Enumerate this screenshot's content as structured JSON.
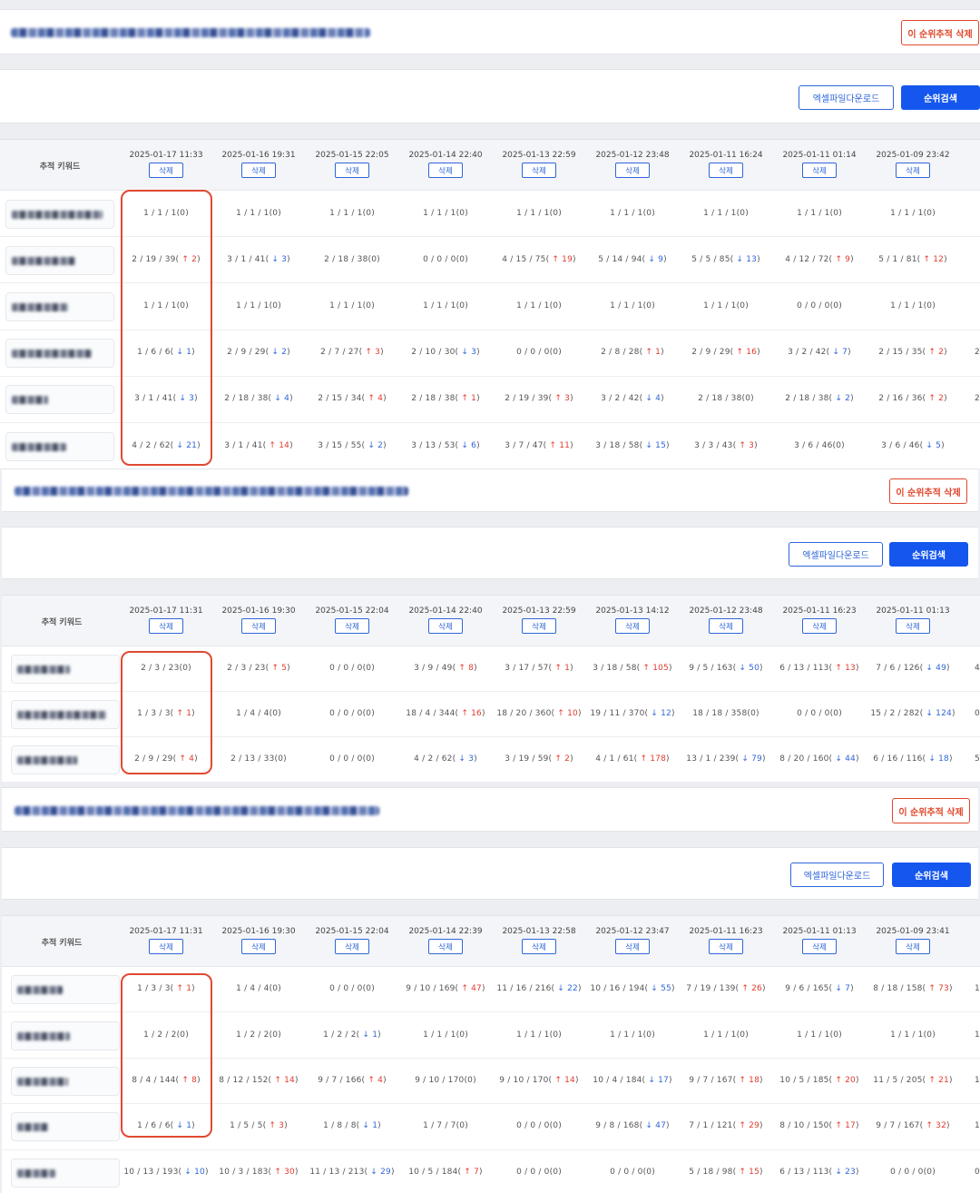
{
  "labels": {
    "delete_tracking": "이 순위추적 삭제",
    "excel_download": "엑셀파일다운로드",
    "rank_search": "순위검색",
    "tracking_keyword": "추적 키워드",
    "delete": "삭제"
  },
  "colors": {
    "accent": "#1557ee",
    "danger": "#e0472b",
    "up_arrow": "#e23a2a",
    "down_arrow": "#2f66d9"
  },
  "tables": [
    {
      "dates": [
        "2025-01-17 11:33",
        "2025-01-16 19:31",
        "2025-01-15 22:05",
        "2025-01-14 22:40",
        "2025-01-13 22:59",
        "2025-01-12 23:48",
        "2025-01-11 16:24",
        "2025-01-11 01:14",
        "2025-01-09 23:42",
        "20"
      ],
      "rows": [
        [
          "1 / 1 / 1(0)",
          "1 / 1 / 1(0)",
          "1 / 1 / 1(0)",
          "1 / 1 / 1(0)",
          "1 / 1 / 1(0)",
          "1 / 1 / 1(0)",
          "1 / 1 / 1(0)",
          "1 / 1 / 1(0)",
          "1 / 1 / 1(0)",
          ""
        ],
        [
          "2 / 19 / 39( ↑ 2)",
          "3 / 1 / 41( ↓ 3)",
          "2 / 18 / 38(0)",
          "0 / 0 / 0(0)",
          "4 / 15 / 75( ↑ 19)",
          "5 / 14 / 94( ↓ 9)",
          "5 / 5 / 85( ↓ 13)",
          "4 / 12 / 72( ↑ 9)",
          "5 / 1 / 81( ↑ 12)",
          ""
        ],
        [
          "1 / 1 / 1(0)",
          "1 / 1 / 1(0)",
          "1 / 1 / 1(0)",
          "1 / 1 / 1(0)",
          "1 / 1 / 1(0)",
          "1 / 1 / 1(0)",
          "1 / 1 / 1(0)",
          "0 / 0 / 0(0)",
          "1 / 1 / 1(0)",
          ""
        ],
        [
          "1 / 6 / 6( ↓ 1)",
          "2 / 9 / 29( ↓ 2)",
          "2 / 7 / 27( ↑ 3)",
          "2 / 10 / 30( ↓ 3)",
          "0 / 0 / 0(0)",
          "2 / 8 / 28( ↑ 1)",
          "2 / 9 / 29( ↑ 16)",
          "3 / 2 / 42( ↓ 7)",
          "2 / 15 / 35( ↑ 2)",
          "2"
        ],
        [
          "3 / 1 / 41( ↓ 3)",
          "2 / 18 / 38( ↓ 4)",
          "2 / 15 / 34( ↑ 4)",
          "2 / 18 / 38( ↑ 1)",
          "2 / 19 / 39( ↑ 3)",
          "3 / 2 / 42( ↓ 4)",
          "2 / 18 / 38(0)",
          "2 / 18 / 38( ↓ 2)",
          "2 / 16 / 36( ↑ 2)",
          "2"
        ],
        [
          "4 / 2 / 62( ↓ 21)",
          "3 / 1 / 41( ↑ 14)",
          "3 / 15 / 55( ↓ 2)",
          "3 / 13 / 53( ↓ 6)",
          "3 / 7 / 47( ↑ 11)",
          "3 / 18 / 58( ↓ 15)",
          "3 / 3 / 43( ↑ 3)",
          "3 / 6 / 46(0)",
          "3 / 6 / 46( ↓ 5)",
          ""
        ]
      ]
    },
    {
      "dates": [
        "2025-01-17 11:31",
        "2025-01-16 19:30",
        "2025-01-15 22:04",
        "2025-01-14 22:40",
        "2025-01-13 22:59",
        "2025-01-13 14:12",
        "2025-01-12 23:48",
        "2025-01-11 16:23",
        "2025-01-11 01:13",
        "2025"
      ],
      "rows": [
        [
          "2 / 3 / 23(0)",
          "2 / 3 / 23( ↑ 5)",
          "0 / 0 / 0(0)",
          "3 / 9 / 49( ↑ 8)",
          "3 / 17 / 57( ↑ 1)",
          "3 / 18 / 58( ↑ 105)",
          "9 / 5 / 163( ↓ 50)",
          "6 / 13 / 113( ↑ 13)",
          "7 / 6 / 126( ↓ 49)",
          "4 /"
        ],
        [
          "1 / 3 / 3( ↑ 1)",
          "1 / 4 / 4(0)",
          "0 / 0 / 0(0)",
          "18 / 4 / 344( ↑ 16)",
          "18 / 20 / 360( ↑ 10)",
          "19 / 11 / 370( ↓ 12)",
          "18 / 18 / 358(0)",
          "0 / 0 / 0(0)",
          "15 / 2 / 282( ↓ 124)",
          "0,"
        ],
        [
          "2 / 9 / 29( ↑ 4)",
          "2 / 13 / 33(0)",
          "0 / 0 / 0(0)",
          "4 / 2 / 62( ↓ 3)",
          "3 / 19 / 59( ↑ 2)",
          "4 / 1 / 61( ↑ 178)",
          "13 / 1 / 239( ↓ 79)",
          "8 / 20 / 160( ↓ 44)",
          "6 / 16 / 116( ↓ 18)",
          "5 / 18"
        ]
      ]
    },
    {
      "dates": [
        "2025-01-17 11:31",
        "2025-01-16 19:30",
        "2025-01-15 22:04",
        "2025-01-14 22:39",
        "2025-01-13 22:58",
        "2025-01-12 23:47",
        "2025-01-11 16:23",
        "2025-01-11 01:13",
        "2025-01-09 23:41",
        "2025"
      ],
      "rows": [
        [
          "1 / 3 / 3( ↑ 1)",
          "1 / 4 / 4(0)",
          "0 / 0 / 0(0)",
          "9 / 10 / 169( ↑ 47)",
          "11 / 16 / 216( ↓ 22)",
          "10 / 16 / 194( ↓ 55)",
          "7 / 19 / 139( ↑ 26)",
          "9 / 6 / 165( ↓ 7)",
          "8 / 18 / 158( ↑ 73)",
          "12 / 1"
        ],
        [
          "1 / 2 / 2(0)",
          "1 / 2 / 2(0)",
          "1 / 2 / 2( ↓ 1)",
          "1 / 1 / 1(0)",
          "1 / 1 / 1(0)",
          "1 / 1 / 1(0)",
          "1 / 1 / 1(0)",
          "1 / 1 / 1(0)",
          "1 / 1 / 1(0)",
          "1"
        ],
        [
          "8 / 4 / 144( ↑ 8)",
          "8 / 12 / 152( ↑ 14)",
          "9 / 7 / 166( ↑ 4)",
          "9 / 10 / 170(0)",
          "9 / 10 / 170( ↑ 14)",
          "10 / 4 / 184( ↓ 17)",
          "9 / 7 / 167( ↑ 18)",
          "10 / 5 / 185( ↑ 20)",
          "11 / 5 / 205( ↑ 21)",
          "12 / 6"
        ],
        [
          "1 / 6 / 6( ↓ 1)",
          "1 / 5 / 5( ↑ 3)",
          "1 / 8 / 8( ↓ 1)",
          "1 / 7 / 7(0)",
          "0 / 0 / 0(0)",
          "9 / 8 / 168( ↓ 47)",
          "7 / 1 / 121( ↑ 29)",
          "8 / 10 / 150( ↑ 17)",
          "9 / 7 / 167( ↑ 32)",
          "10 / 1"
        ],
        [
          "10 / 13 / 193( ↓ 10)",
          "10 / 3 / 183( ↑ 30)",
          "11 / 13 / 213( ↓ 29)",
          "10 / 5 / 184( ↑ 7)",
          "0 / 0 / 0(0)",
          "0 / 0 / 0(0)",
          "5 / 18 / 98( ↑ 15)",
          "6 / 13 / 113( ↓ 23)",
          "0 / 0 / 0(0)",
          "0"
        ]
      ]
    }
  ]
}
